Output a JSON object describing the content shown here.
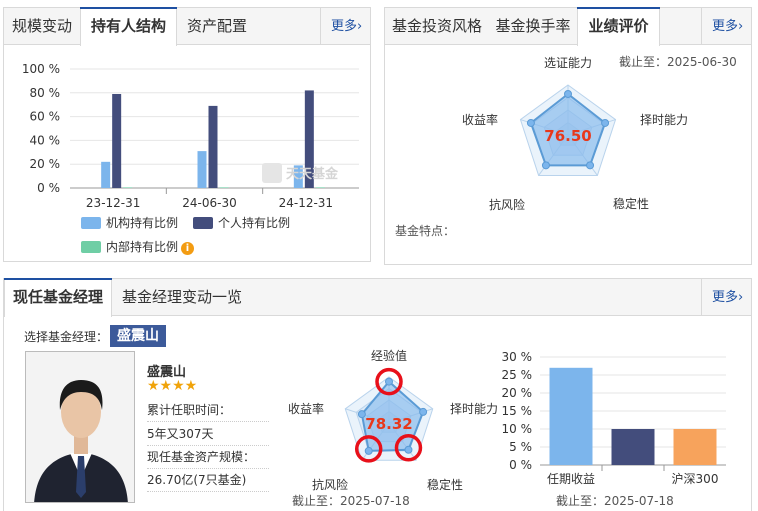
{
  "holder_panel": {
    "tabs": [
      "规模变动",
      "持有人结构",
      "资产配置"
    ],
    "active_tab": 1,
    "more": "更多›",
    "watermark": "天天基金"
  },
  "eval_panel": {
    "tabs": [
      "基金投资风格",
      "基金换手率",
      "业绩评价"
    ],
    "active_tab": 2,
    "more": "更多›",
    "deadline": "截止至：2025-06-30",
    "features_label": "基金特点：",
    "score": "76.50",
    "radar_labels": [
      "选证能力",
      "择时能力",
      "稳定性",
      "抗风险",
      "收益率"
    ]
  },
  "manager_panel": {
    "tabs": [
      "现任基金经理",
      "基金经理变动一览"
    ],
    "active_tab": 0,
    "more": "更多›",
    "select_label": "选择基金经理：",
    "manager_name_tag": "盛震山",
    "manager_name": "盛震山",
    "stars": "★★★★",
    "tenure_label": "累计任职时间：",
    "tenure_value": "5年又307天",
    "assets_label": "现任基金资产规模：",
    "assets_value": "26.70亿(7只基金)",
    "score": "78.32",
    "radar_labels": [
      "经验值",
      "择时能力",
      "稳定性",
      "抗风险",
      "收益率"
    ],
    "radar_deadline": "截止至：2025-07-18",
    "bar_deadline": "截止至：2025-07-18"
  },
  "chart_data": [
    {
      "type": "bar",
      "categories": [
        "23-12-31",
        "24-06-30",
        "24-12-31"
      ],
      "series": [
        {
          "name": "机构持有比例",
          "color": "#7cb5ec",
          "values": [
            22,
            31,
            19
          ]
        },
        {
          "name": "个人持有比例",
          "color": "#434d7c",
          "values": [
            79,
            69,
            82
          ]
        },
        {
          "name": "内部持有比例",
          "color": "#6fcea5",
          "values": [
            0.5,
            0.5,
            0.5
          ]
        }
      ],
      "yticks": [
        "100 %",
        "80 %",
        "60 %",
        "40 %",
        "20 %",
        "0 %"
      ],
      "ylim": [
        0,
        100
      ]
    },
    {
      "type": "radar",
      "axes": [
        "选证能力",
        "择时能力",
        "稳定性",
        "抗风险",
        "收益率"
      ],
      "values": [
        0.82,
        0.78,
        0.75,
        0.75,
        0.78
      ],
      "score": "76.50"
    },
    {
      "type": "radar",
      "axes": [
        "经验值",
        "择时能力",
        "稳定性",
        "抗风险",
        "收益率"
      ],
      "values": [
        0.9,
        0.78,
        0.72,
        0.75,
        0.62
      ],
      "highlighted": [
        "经验值",
        "稳定性",
        "抗风险"
      ],
      "score": "78.32"
    },
    {
      "type": "bar",
      "categories": [
        "任期收益",
        "",
        "沪深300"
      ],
      "values": [
        27,
        10,
        10
      ],
      "colors": [
        "#7cb5ec",
        "#434d7c",
        "#f7a35c"
      ],
      "yticks": [
        "30 %",
        "25 %",
        "20 %",
        "15 %",
        "10 %",
        "5 %",
        "0 %"
      ],
      "ylim": [
        0,
        30
      ]
    }
  ]
}
